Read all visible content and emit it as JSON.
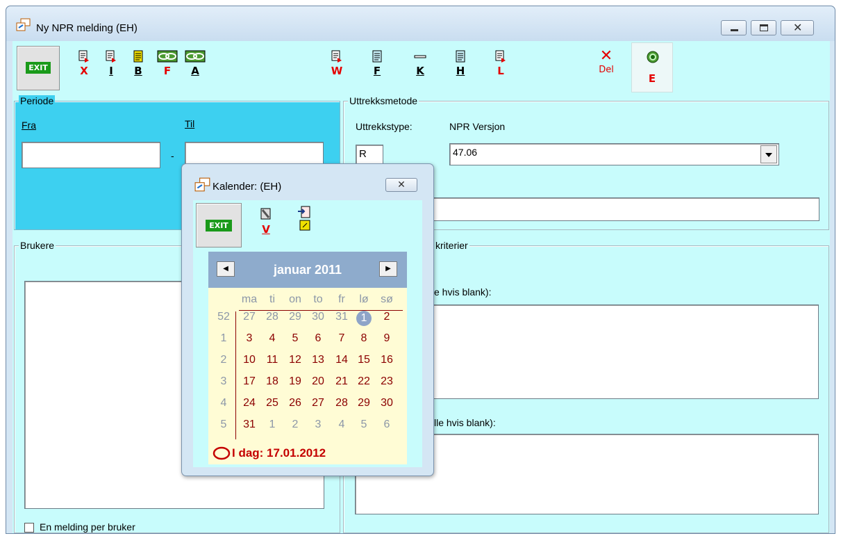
{
  "window": {
    "title": "Ny NPR melding (EH)"
  },
  "toolbar": {
    "exit_label": "EXIT",
    "buttons": [
      {
        "label": "X"
      },
      {
        "label": "I"
      },
      {
        "label": "B"
      },
      {
        "label": "F"
      },
      {
        "label": "A"
      },
      {
        "label": "W"
      },
      {
        "label": "F"
      },
      {
        "label": "K"
      },
      {
        "label": "H"
      },
      {
        "label": "L"
      },
      {
        "label": "Del"
      },
      {
        "label": "E"
      }
    ]
  },
  "periode": {
    "legend": "Periode",
    "fra_label": "Fra",
    "til_label": "Til",
    "fra_value": "",
    "til_value": "",
    "separator": "-"
  },
  "uttrekk": {
    "legend": "Uttrekksmetode",
    "type_label": "Uttrekkstype:",
    "type_value": "R",
    "version_label": "NPR Versjon",
    "version_value": "47.06"
  },
  "brukere": {
    "legend": "Brukere",
    "checkbox_label": "En melding per bruker"
  },
  "kriterier": {
    "legend_fragment": "kriterier",
    "hint1": "e hvis blank):",
    "hint2": "lle hvis blank):"
  },
  "calendar": {
    "title": "Kalender: (EH)",
    "exit_label": "EXIT",
    "v_label": "V",
    "month": "januar 2011",
    "dow": [
      "ma",
      "ti",
      "on",
      "to",
      "fr",
      "lø",
      "sø"
    ],
    "weeks": [
      {
        "wk": "52",
        "days": [
          "27",
          "28",
          "29",
          "30",
          "31",
          "1",
          "2"
        ]
      },
      {
        "wk": "1",
        "days": [
          "3",
          "4",
          "5",
          "6",
          "7",
          "8",
          "9"
        ]
      },
      {
        "wk": "2",
        "days": [
          "10",
          "11",
          "12",
          "13",
          "14",
          "15",
          "16"
        ]
      },
      {
        "wk": "3",
        "days": [
          "17",
          "18",
          "19",
          "20",
          "21",
          "22",
          "23"
        ]
      },
      {
        "wk": "4",
        "days": [
          "24",
          "25",
          "26",
          "27",
          "28",
          "29",
          "30"
        ]
      },
      {
        "wk": "5",
        "days": [
          "31",
          "1",
          "2",
          "3",
          "4",
          "5",
          "6"
        ]
      }
    ],
    "today": "I dag: 17.01.2012"
  },
  "colors": {
    "accent_blue": "#3dd0f0",
    "client_bg": "#c8fcfc",
    "red": "#e40000"
  }
}
